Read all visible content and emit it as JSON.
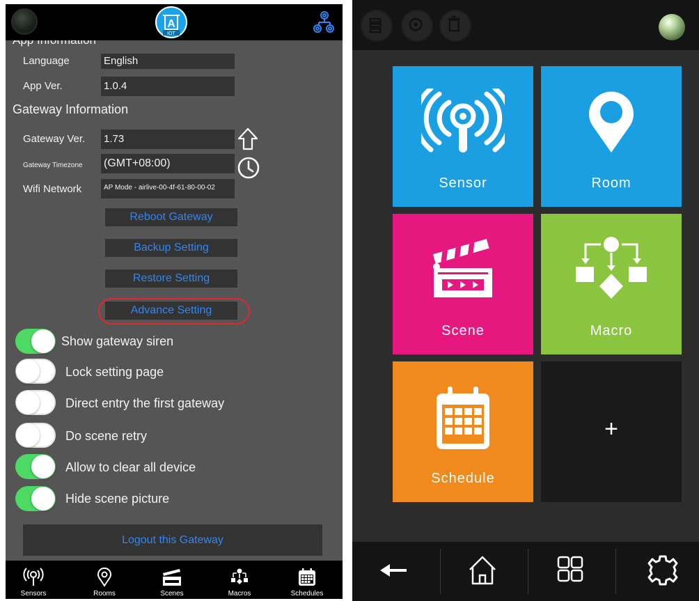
{
  "left": {
    "header": {
      "logo_text": "IOT",
      "status_icon": "status-dot-icon",
      "settings_icon": "settings-network-icon"
    },
    "app_info_title": "App Information",
    "language_label": "Language",
    "language_value": "English",
    "app_ver_label": "App Ver.",
    "app_ver_value": "1.0.4",
    "gateway_info_title": "Gateway Information",
    "gateway_ver_label": "Gateway Ver.",
    "gateway_ver_value": "1.73",
    "gateway_tz_label": "Gateway Timezone",
    "gateway_tz_value": "(GMT+08:00)",
    "wifi_label": "Wifi Network",
    "wifi_value": "AP Mode - airlive-00-4f-61-80-00-02",
    "buttons": {
      "reboot": "Reboot Gateway",
      "backup": "Backup Setting",
      "restore": "Restore Setting",
      "advance": "Advance Setting"
    },
    "toggles": [
      {
        "label": "Show gateway siren",
        "on": true
      },
      {
        "label": "Lock setting page",
        "on": false
      },
      {
        "label": "Direct entry the first gateway",
        "on": false
      },
      {
        "label": "Do scene retry",
        "on": false
      },
      {
        "label": "Allow to clear all device",
        "on": true
      },
      {
        "label": "Hide scene picture",
        "on": true
      }
    ],
    "logout": "Logout this Gateway",
    "tabs": [
      "Sensors",
      "Rooms",
      "Scenes",
      "Macros",
      "Schedules"
    ]
  },
  "right": {
    "tiles": {
      "sensor": "Sensor",
      "room": "Room",
      "scene": "Scene",
      "macro": "Macro",
      "schedule": "Schedule",
      "add": "+"
    },
    "colors": {
      "sensor": "#1a9fe3",
      "room": "#1a9fe3",
      "scene": "#e6177f",
      "macro": "#8bc53f",
      "schedule": "#f08a1c",
      "toggle_on": "#4cd964",
      "link_blue": "#2f86f5",
      "highlight": "#e0262c"
    },
    "bottom_nav": [
      "back-arrow-icon",
      "home-icon",
      "grid-icon",
      "gear-icon"
    ]
  }
}
